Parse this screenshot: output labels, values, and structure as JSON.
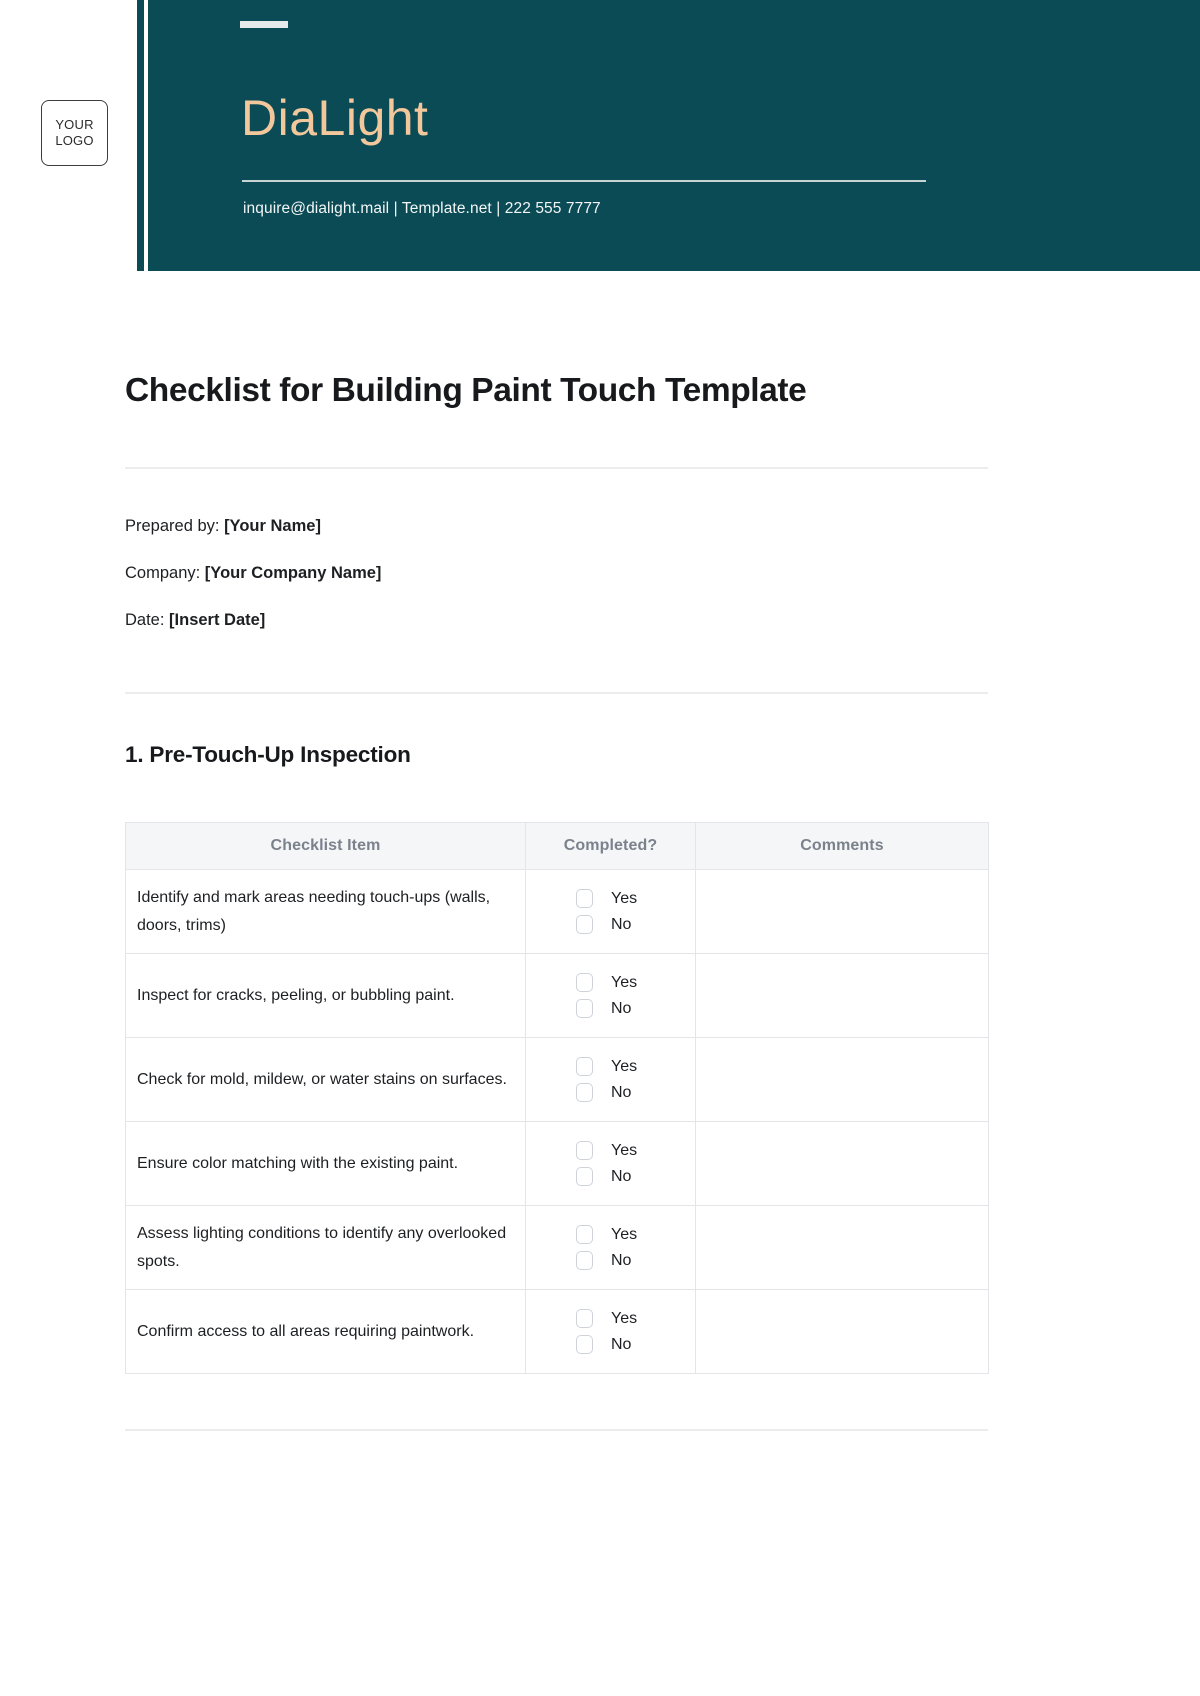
{
  "header": {
    "logo_line1": "YOUR",
    "logo_line2": "LOGO",
    "brand_name": "DiaLight",
    "contact": "inquire@dialight.mail | Template.net | 222 555 7777",
    "banner_color": "#0b4b55",
    "brand_color": "#f2c79c"
  },
  "document": {
    "title": "Checklist for Building Paint Touch Template",
    "meta": [
      {
        "label": "Prepared by: ",
        "value": "[Your Name]"
      },
      {
        "label": "Company: ",
        "value": "[Your Company Name]"
      },
      {
        "label": "Date: ",
        "value": "[Insert Date]"
      }
    ]
  },
  "section": {
    "heading": "1. Pre-Touch-Up Inspection",
    "table": {
      "columns": [
        "Checklist Item",
        "Completed?",
        "Comments"
      ],
      "options": [
        "Yes",
        "No"
      ],
      "rows": [
        {
          "item": "Identify and mark areas needing touch-ups (walls, doors, trims)",
          "comment": ""
        },
        {
          "item": "Inspect for cracks, peeling, or bubbling paint.",
          "comment": ""
        },
        {
          "item": "Check for mold, mildew, or water stains on surfaces.",
          "comment": ""
        },
        {
          "item": "Ensure color matching with the existing paint.",
          "comment": ""
        },
        {
          "item": "Assess lighting conditions to identify any overlooked spots.",
          "comment": ""
        },
        {
          "item": "Confirm access to all areas requiring paintwork.",
          "comment": ""
        }
      ]
    }
  }
}
